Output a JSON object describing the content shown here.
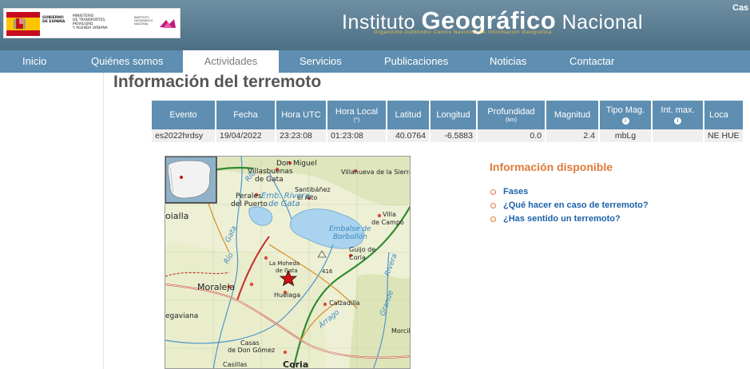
{
  "header": {
    "gov_logo": {
      "gobierno": [
        "GOBIERNO",
        "DE ESPAÑA"
      ],
      "ministerio": [
        "MINISTERIO",
        "DE TRANSPORTES, MOVILIDAD",
        "Y AGENDA URBANA"
      ],
      "instituto": [
        "INSTITUTO",
        "GEOGRÁFICO",
        "NACIONAL"
      ],
      "flag_colors": [
        "#c60b1e",
        "#ffc400"
      ]
    },
    "brand": {
      "pre": "Instituto ",
      "big": "Geográfico",
      "post": " Nacional",
      "subtitle": "Organismo Autónomo Centro Nacional de Información Geográfica"
    },
    "lang_label": "Cas"
  },
  "nav": {
    "items": [
      "Inicio",
      "Quiénes somos",
      "Actividades",
      "Servicios",
      "Publicaciones",
      "Noticias",
      "Contactar"
    ],
    "active": "Actividades"
  },
  "page_title": "Información del terremoto",
  "quake_table": {
    "headers": {
      "evento": "Evento",
      "fecha": "Fecha",
      "hora_utc": "Hora UTC",
      "hora_local": "Hora Local",
      "hora_local_note": "(*)",
      "latitud": "Latitud",
      "longitud": "Longitud",
      "profundidad": "Profundidad",
      "profundidad_unit": "(km)",
      "magnitud": "Magnitud",
      "tipo_mag": "Tipo Mag.",
      "int_max": "Int. max.",
      "localizacion": "Loca"
    },
    "row": {
      "evento": "es2022hrdsy",
      "fecha": "19/04/2022",
      "hora_utc": "23:23:08",
      "hora_local": "01:23:08",
      "latitud": "40.0764",
      "longitud": "-6.5883",
      "profundidad": "0.0",
      "magnitud": "2.4",
      "tipo_mag": "mbLg",
      "int_max": "",
      "localizacion": "NE HUE"
    }
  },
  "map": {
    "place_labels": {
      "don_miguel": "Don Miguel",
      "villasbuenas": "Villasbuenas",
      "de_gata": "de Gata",
      "villanueva": "Villanueva de la Sierra",
      "perales": "Perales",
      "del_puerto": "del Puerto",
      "emb_rivera": "Emb. Rivera",
      "de_gata_2": "de Gata",
      "santibanez": "Santibáñez",
      "el_alto": "el Alto",
      "villa": "Villa",
      "de_campo": "de Campo",
      "oialla": "oialla",
      "embalse": "Embalse de",
      "borbollon": "Borbollón",
      "guijo": "Guijo de",
      "coria_2": "Coria",
      "gata_river": "Gata",
      "rio": "Río",
      "la_moheda": "La Moheda",
      "de_gata_3": "de Gata",
      "alt_416": "416",
      "moraleja": "Moraleja",
      "huelaga": "Huélaga",
      "calzadilla": "Calzadilla",
      "egaviana": "egaviana",
      "morcil": "Morcil",
      "casas": "Casas",
      "de_don_gomez": "de Don Gómez",
      "casillas": "Casillas",
      "coria": "Coria",
      "grande": "Grande",
      "rivera": "Rivera",
      "arrago": "Árrago"
    },
    "epicenter_color": "#d01010"
  },
  "info": {
    "title": "Información disponible",
    "links": [
      "Fases",
      "¿Qué hacer en caso de terremoto?",
      "¿Has sentido un terremoto?"
    ]
  }
}
